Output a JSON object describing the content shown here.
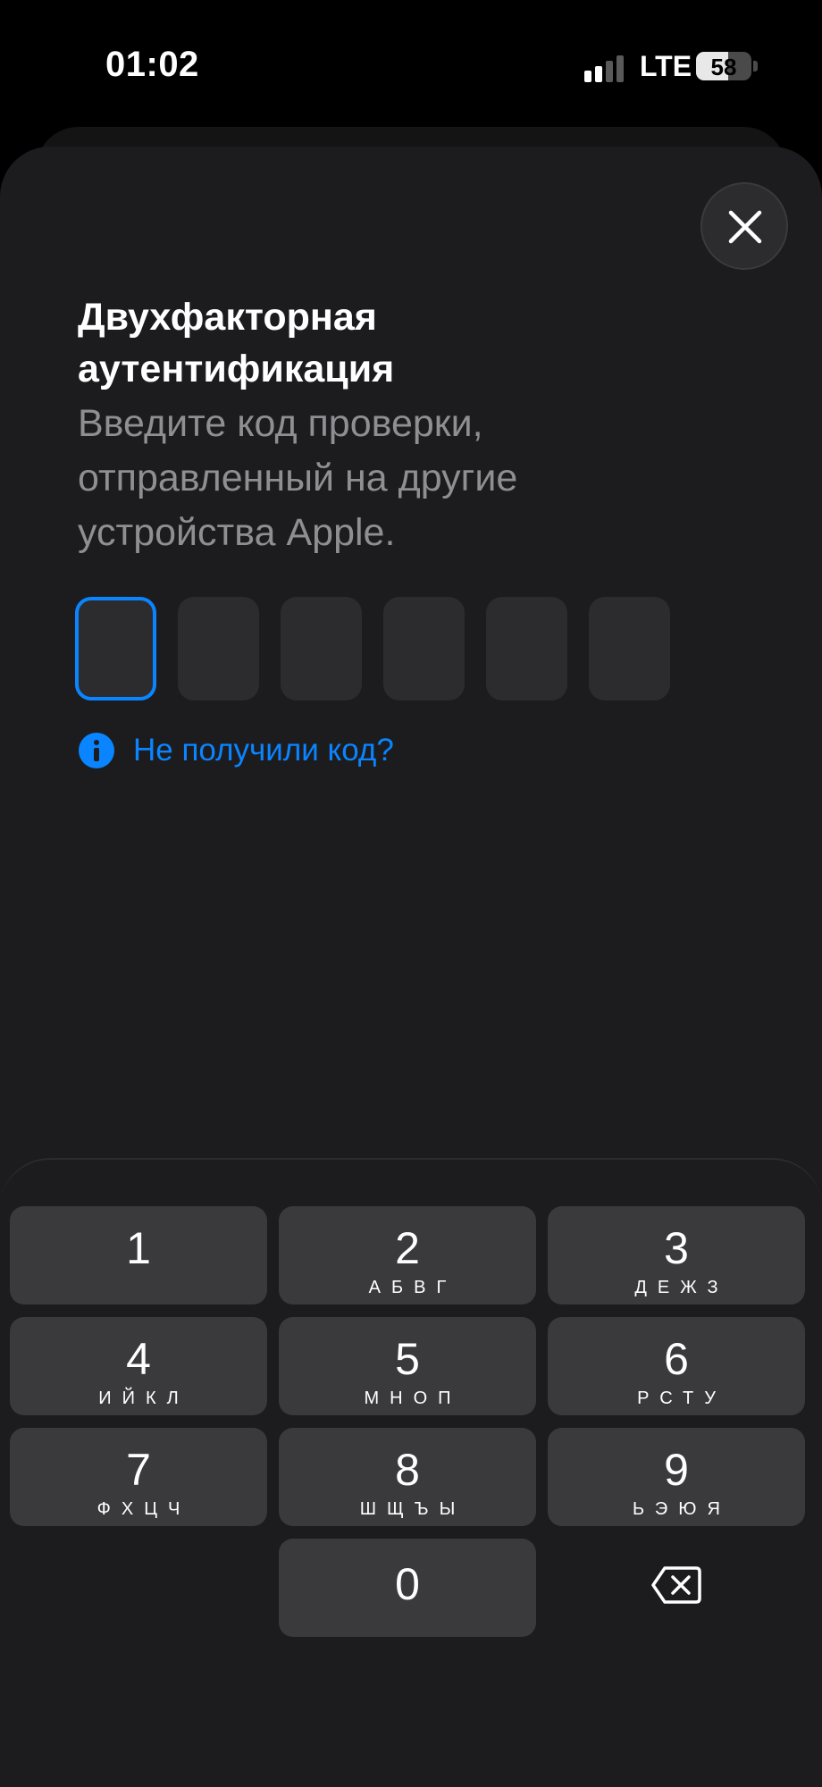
{
  "status_bar": {
    "time": "01:02",
    "network": "LTE",
    "battery_level": "58",
    "battery_fraction": 0.58,
    "signal_bars_active": 2,
    "signal_bars_total": 4
  },
  "dialog": {
    "title": "Двухфакторная аутентификация",
    "subtitle": "Введите код проверки, отправленный на другие устройства Apple.",
    "code_length": 6,
    "active_box": 1,
    "help_link": "Не получили код?",
    "close_icon": "close-icon",
    "info_icon": "info-icon"
  },
  "keypad": {
    "keys": [
      {
        "digit": "1",
        "letters": ""
      },
      {
        "digit": "2",
        "letters": "АБВГ"
      },
      {
        "digit": "3",
        "letters": "ДЕЖЗ"
      },
      {
        "digit": "4",
        "letters": "ИЙКЛ"
      },
      {
        "digit": "5",
        "letters": "МНОП"
      },
      {
        "digit": "6",
        "letters": "РСТУ"
      },
      {
        "digit": "7",
        "letters": "ФХЦЧ"
      },
      {
        "digit": "8",
        "letters": "ШЩЪЫ"
      },
      {
        "digit": "9",
        "letters": "ЬЭЮЯ"
      },
      {
        "digit": "0",
        "letters": ""
      }
    ],
    "backspace_icon": "backspace-icon"
  },
  "colors": {
    "accent": "#0a84ff",
    "sheet": "#1c1c1e",
    "key": "#3a3a3c",
    "secondary_text": "#8e8e93"
  }
}
